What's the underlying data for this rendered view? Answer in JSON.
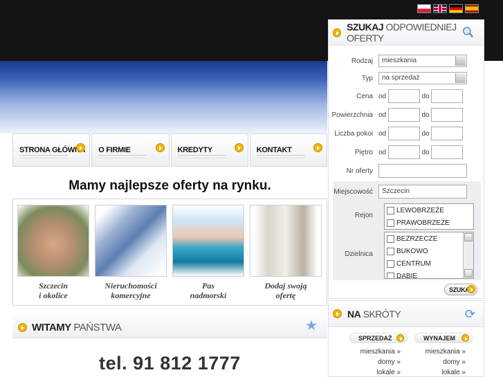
{
  "flags": [
    "flag-pl",
    "flag-en",
    "flag-de",
    "flag-es"
  ],
  "nav": [
    {
      "label": "STRONA GŁÓWNA",
      "name": "nav-strona-glowna"
    },
    {
      "label": "O FIRMIE",
      "name": "nav-o-firmie"
    },
    {
      "label": "KREDYTY",
      "name": "nav-kredyty"
    },
    {
      "label": "KONTAKT",
      "name": "nav-kontakt"
    }
  ],
  "headline": "Mamy najlepsze oferty na rynku.",
  "gallery": [
    {
      "line1": "Szczecin",
      "line2": "i okolice"
    },
    {
      "line1": "Nieruchomości",
      "line2": "komercyjne"
    },
    {
      "line1": "Pas",
      "line2": "nadmorski"
    },
    {
      "line1": "Dodaj swoją",
      "line2": "ofertę"
    }
  ],
  "welcome": {
    "bold": "WITAMY",
    "rest": " PAŃSTWA"
  },
  "phone": "tel. 91 812 1777",
  "search": {
    "title_bold": "SZUKAJ",
    "title_rest": " ODPOWIEDNIEJ OFERTY",
    "rodzaj_label": "Rodzaj",
    "rodzaj_value": "mieszkania",
    "typ_label": "Typ",
    "typ_value": "na sprzedaż",
    "cena_label": "Cena",
    "powierzchnia_label": "Powierzchnia",
    "pokoi_label": "Liczba pokoi",
    "pietro_label": "Piętro",
    "od": "od",
    "do": "do",
    "nr_label": "Nr oferty",
    "miejscowosc_label": "Miejscowość",
    "miejscowosc_value": "Szczecin",
    "rejon_label": "Rejon",
    "rejon_options": [
      "LEWOBRZEŻE",
      "PRAWOBRZEŻE"
    ],
    "dzielnica_label": "Dzielnica",
    "dzielnica_options": [
      "BEZRZECZE",
      "BUKOWO",
      "CENTRUM",
      "DĄBIE"
    ],
    "submit": "SZUKAJ"
  },
  "shortcuts": {
    "title_bold": "NA",
    "title_rest": " SKRÓTY",
    "sprzedaz": "SPRZEDAŻ",
    "wynajem": "WYNAJEM",
    "sale_links": [
      "mieszkania »",
      "domy »",
      "lokale »"
    ],
    "rent_links": [
      "mieszkania »",
      "domy »",
      "lokale »"
    ]
  }
}
